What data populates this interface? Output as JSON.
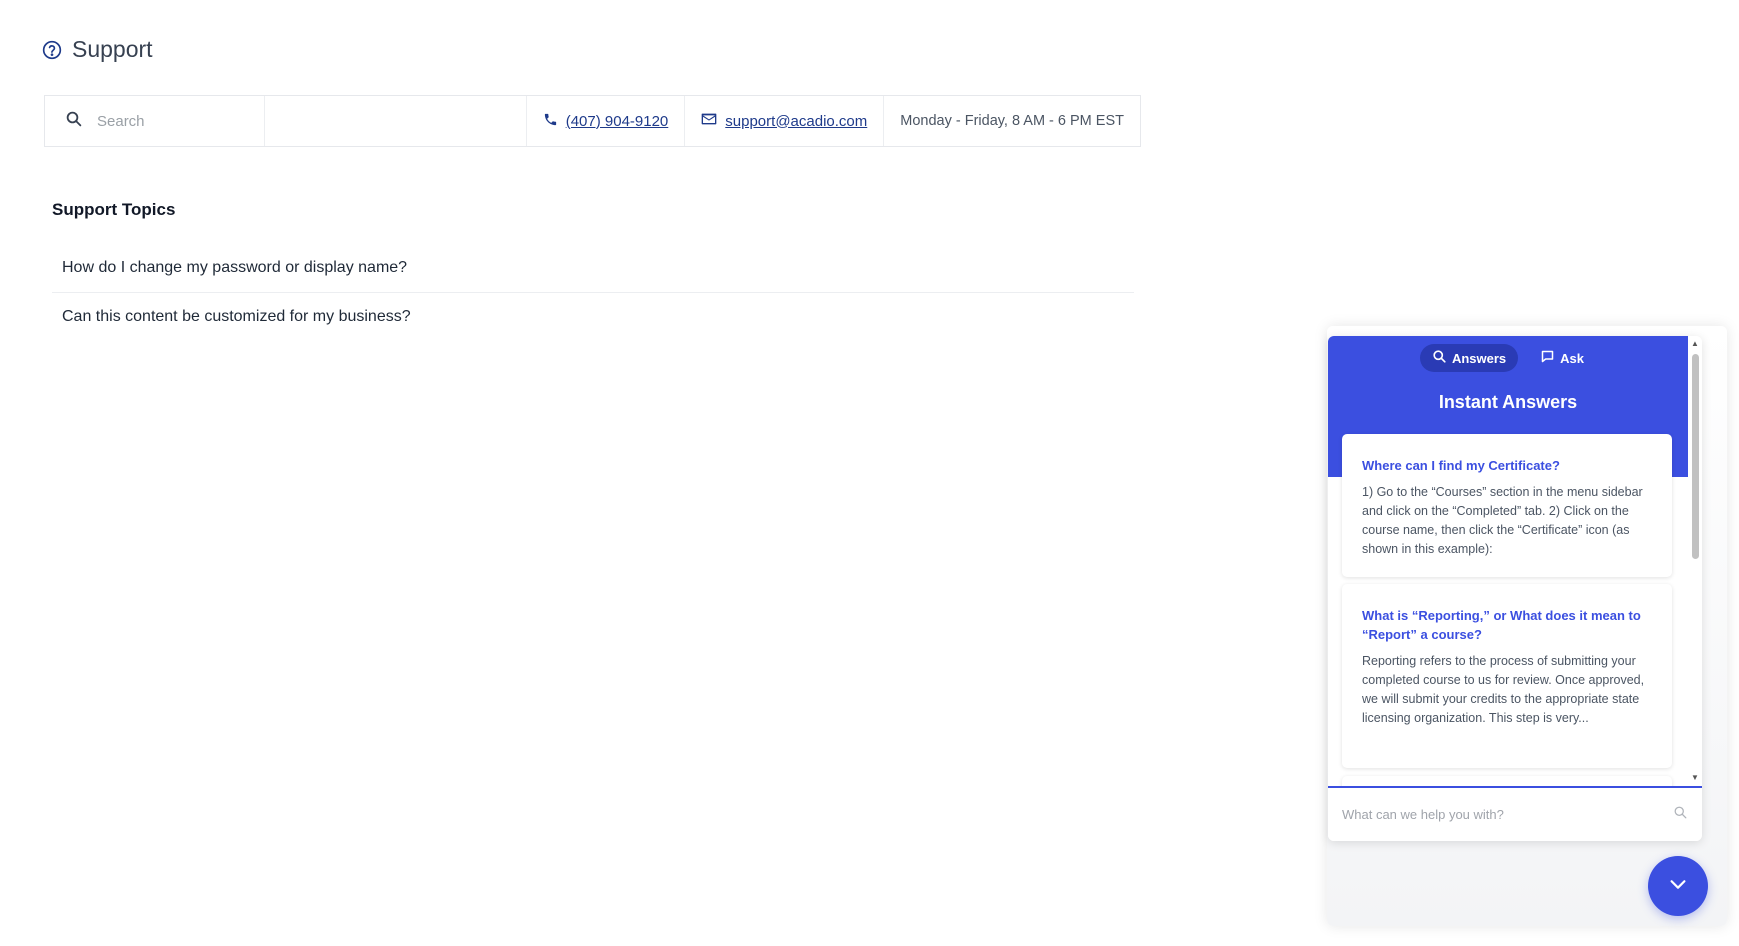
{
  "header": {
    "title": "Support",
    "icon": "help-circle-icon"
  },
  "contact_bar": {
    "search_placeholder": "Search",
    "phone": "(407) 904-9120",
    "email": "support@acadio.com",
    "hours": "Monday - Friday, 8 AM - 6 PM EST"
  },
  "topics": {
    "title": "Support Topics",
    "items": [
      {
        "label": "How do I change my password or display name?"
      },
      {
        "label": "Can this content be customized for my business?"
      }
    ]
  },
  "widget": {
    "tabs": [
      {
        "label": "Answers",
        "icon": "search-icon",
        "active": true
      },
      {
        "label": "Ask",
        "icon": "chat-bubble-icon",
        "active": false
      }
    ],
    "heading": "Instant Answers",
    "answers": [
      {
        "question": "Where can I find my Certificate?",
        "answer": "1) Go to the “Courses” section in the menu sidebar and click on the “Completed” tab. 2) Click on the course name, then click the “Certificate” icon (as shown in this example):"
      },
      {
        "question": "What is “Reporting,” or What does it mean to “Report” a course?",
        "answer": "Reporting refers to the process of submitting your completed course to us for review. Once approved, we will submit your credits to the appropriate state licensing organization. This step is very..."
      }
    ],
    "input_placeholder": "What can we help you with?",
    "launcher_icon": "chevron-down-icon"
  },
  "colors": {
    "brand_blue": "#3b4fe0",
    "link_blue": "#1e3a8a"
  }
}
